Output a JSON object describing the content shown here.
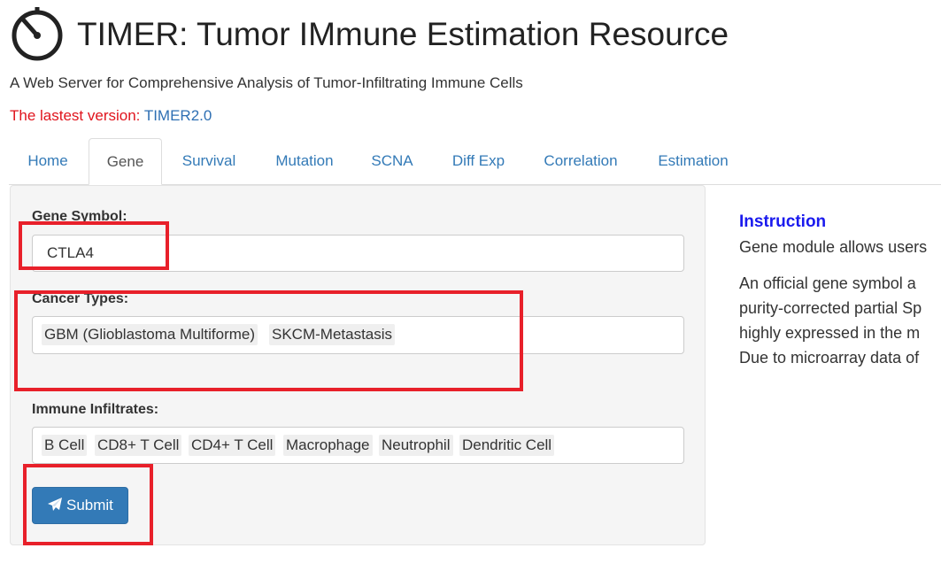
{
  "header": {
    "title": "TIMER: Tumor IMmune Estimation Resource",
    "subtitle": "A Web Server for Comprehensive Analysis of Tumor-Infiltrating Immune Cells",
    "version_label": "The lastest version: ",
    "version_link": "TIMER2.0"
  },
  "tabs": [
    {
      "label": "Home"
    },
    {
      "label": "Gene"
    },
    {
      "label": "Survival"
    },
    {
      "label": "Mutation"
    },
    {
      "label": "SCNA"
    },
    {
      "label": "Diff Exp"
    },
    {
      "label": "Correlation"
    },
    {
      "label": "Estimation"
    }
  ],
  "form": {
    "gene_label": "Gene Symbol:",
    "gene_value": "CTLA4",
    "cancer_label": "Cancer Types:",
    "cancer_selected": [
      "GBM (Glioblastoma Multiforme)",
      "SKCM-Metastasis"
    ],
    "immune_label": "Immune Infiltrates:",
    "immune_selected": [
      "B Cell",
      "CD8+ T Cell",
      "CD4+ T Cell",
      "Macrophage",
      "Neutrophil",
      "Dendritic Cell"
    ],
    "submit_label": "Submit"
  },
  "instruction": {
    "title": "Instruction",
    "lines": [
      "Gene module allows users",
      "An official gene symbol a",
      "purity-corrected partial Sp",
      "highly expressed in the m",
      "Due to microarray data of"
    ]
  },
  "colors": {
    "link": "#337ab7",
    "primary_button": "#337ab7",
    "highlight_box": "#e8202a",
    "version_text": "#e0141d",
    "instruction_title": "#1a1aee"
  },
  "icons": {
    "logo": "stopwatch-icon",
    "submit": "paper-plane-icon"
  }
}
